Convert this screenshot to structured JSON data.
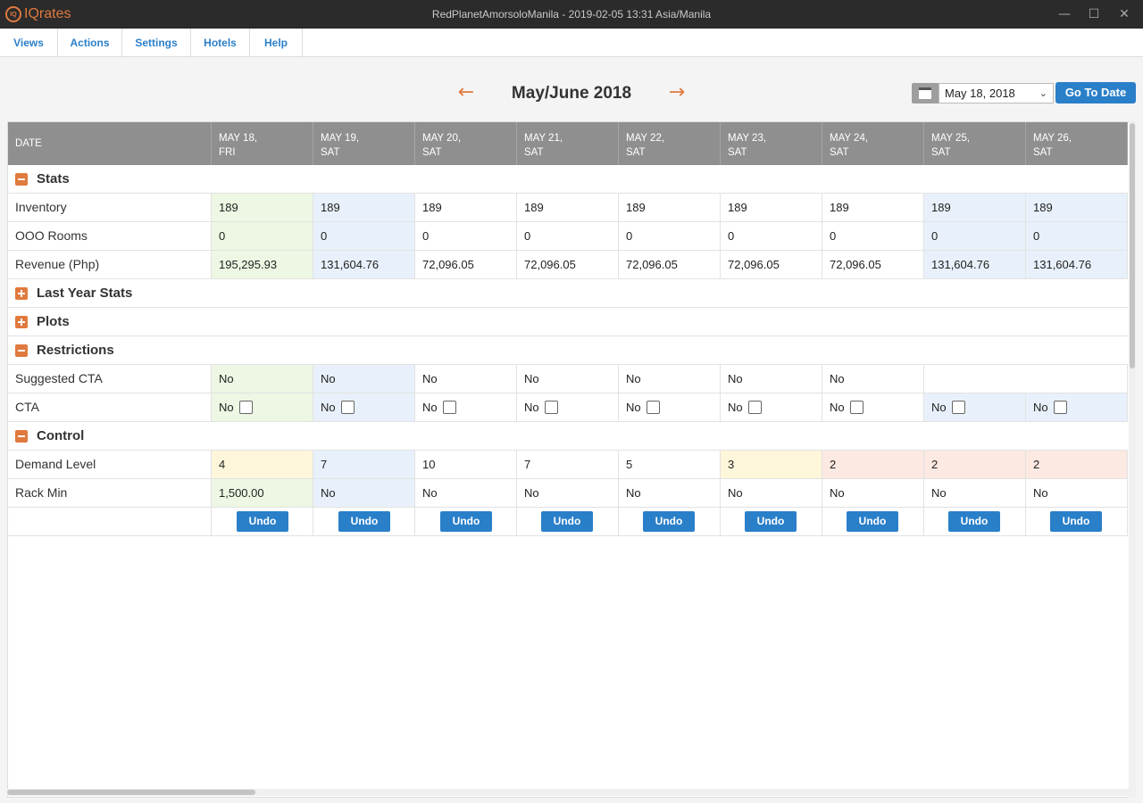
{
  "app": {
    "logo_text": "IQrates",
    "logo_badge": "IQ",
    "window_title": "RedPlanetAmorsoloManila - 2019-02-05 13:31 Asia/Manila",
    "controls": {
      "minimize": "—",
      "maximize": "☐",
      "close": "✕"
    }
  },
  "menu": [
    "Views",
    "Actions",
    "Settings",
    "Hotels",
    "Help"
  ],
  "nav": {
    "title": "May/June 2018",
    "prev": "←",
    "next": "→",
    "selected_date": "May 18, 2018",
    "goto_label": "Go To Date",
    "calendar_icon_day": "3"
  },
  "grid": {
    "header_label": "DATE",
    "dates": [
      {
        "line1": "MAY 18,",
        "line2": "FRI"
      },
      {
        "line1": "MAY 19,",
        "line2": "SAT"
      },
      {
        "line1": "MAY 20,",
        "line2": "SAT"
      },
      {
        "line1": "MAY 21,",
        "line2": "SAT"
      },
      {
        "line1": "MAY 22,",
        "line2": "SAT"
      },
      {
        "line1": "MAY 23,",
        "line2": "SAT"
      },
      {
        "line1": "MAY 24,",
        "line2": "SAT"
      },
      {
        "line1": "MAY 25,",
        "line2": "SAT"
      },
      {
        "line1": "MAY 26,",
        "line2": "SAT"
      }
    ],
    "sections": {
      "stats": "Stats",
      "last_year": "Last Year Stats",
      "plots": "Plots",
      "restrictions": "Restrictions",
      "control": "Control"
    },
    "rows": {
      "inventory": {
        "label": "Inventory",
        "values": [
          "189",
          "189",
          "189",
          "189",
          "189",
          "189",
          "189",
          "189",
          "189"
        ]
      },
      "ooo": {
        "label": "OOO Rooms",
        "values": [
          "0",
          "0",
          "0",
          "0",
          "0",
          "0",
          "0",
          "0",
          "0"
        ]
      },
      "revenue": {
        "label": "Revenue (Php)",
        "values": [
          "195,295.93",
          "131,604.76",
          "72,096.05",
          "72,096.05",
          "72,096.05",
          "72,096.05",
          "72,096.05",
          "131,604.76",
          "131,604.76"
        ]
      },
      "suggested_cta": {
        "label": "Suggested CTA",
        "values": [
          "No",
          "No",
          "No",
          "No",
          "No",
          "No",
          "No",
          "",
          ""
        ]
      },
      "cta": {
        "label": "CTA",
        "values": [
          "No",
          "No",
          "No",
          "No",
          "No",
          "No",
          "No",
          "No",
          "No"
        ]
      },
      "demand": {
        "label": "Demand Level",
        "values": [
          "4",
          "7",
          "10",
          "7",
          "5",
          "3",
          "2",
          "2",
          "2"
        ]
      },
      "rack_min": {
        "label": "Rack Min",
        "values": [
          "1,500.00",
          "No",
          "No",
          "No",
          "No",
          "No",
          "No",
          "No",
          "No"
        ]
      }
    },
    "undo_label": "Undo",
    "colors": {
      "green": "#edf7e3",
      "blue": "#e8f1fb",
      "yellow": "#fdf6da",
      "red": "#fce9e2",
      "accent": "#e07a3e",
      "button": "#2a7fc9"
    }
  }
}
